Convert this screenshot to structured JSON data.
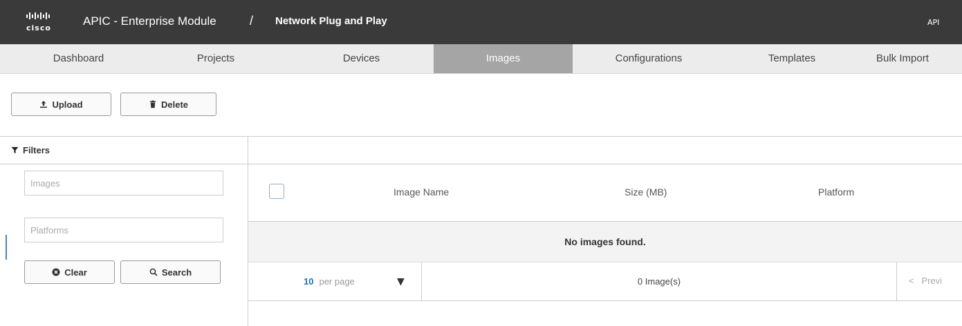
{
  "header": {
    "logo_text": "cisco",
    "app_title": "APIC - Enterprise Module",
    "separator": "/",
    "page_name": "Network Plug and Play",
    "api_label": "API"
  },
  "tabs": [
    {
      "label": "Dashboard",
      "active": false
    },
    {
      "label": "Projects",
      "active": false
    },
    {
      "label": "Devices",
      "active": false
    },
    {
      "label": "Images",
      "active": true
    },
    {
      "label": "Configurations",
      "active": false
    },
    {
      "label": "Templates",
      "active": false
    },
    {
      "label": "Bulk Import",
      "active": false
    }
  ],
  "toolbar": {
    "upload_label": "Upload",
    "delete_label": "Delete"
  },
  "filters": {
    "title": "Filters",
    "images_placeholder": "Images",
    "platforms_placeholder": "Platforms",
    "clear_label": "Clear",
    "search_label": "Search"
  },
  "table": {
    "columns": [
      "Image Name",
      "Size (MB)",
      "Platform"
    ],
    "empty_message": "No images found.",
    "per_page_value": "10",
    "per_page_label": "per page",
    "count_text": "0 Image(s)",
    "prev_label": "Previ"
  },
  "colors": {
    "header_bg": "#3a3a3a",
    "tab_bg": "#ececec",
    "tab_active_bg": "#a5a5a5",
    "link_blue": "#1f6fb3"
  }
}
